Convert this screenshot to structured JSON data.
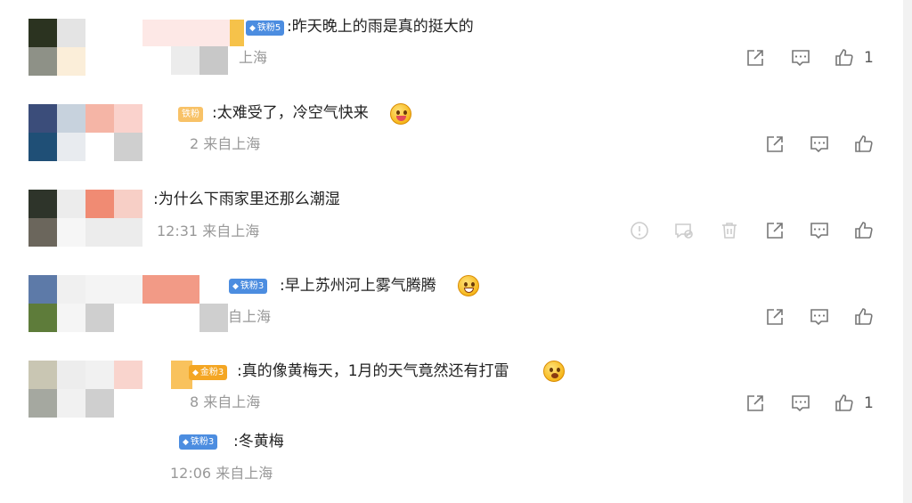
{
  "comments": [
    {
      "badge": "铁粉5",
      "text": ":昨天晚上的雨是真的挺大的",
      "meta": "上海",
      "like_count": "1"
    },
    {
      "badge": "铁粉",
      "text": ":太难受了，冷空气快来",
      "meta": "2 来自上海",
      "like_count": ""
    },
    {
      "badge": "",
      "text": ":为什么下雨家里还那么潮湿",
      "meta": "12:31 来自上海",
      "like_count": ""
    },
    {
      "badge": "铁粉3",
      "text": ":早上苏州河上雾气腾腾",
      "meta": "自上海",
      "like_count": ""
    },
    {
      "badge": "金粉3",
      "text": ":真的像黄梅天，1月的天气竟然还有打雷",
      "meta": "8 来自上海",
      "like_count": "1"
    }
  ],
  "reply": {
    "badge": "铁粉3",
    "text": ":冬黄梅",
    "meta": "12:06 来自上海"
  },
  "icons": {
    "share": "share-icon",
    "comment": "comment-icon",
    "like": "thumbs-up-icon",
    "report": "report-icon",
    "block": "block-icon",
    "delete": "delete-icon"
  }
}
